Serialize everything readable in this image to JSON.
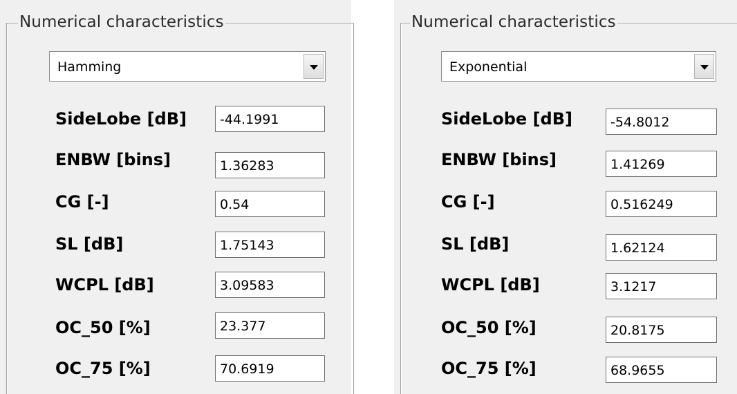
{
  "panels": [
    {
      "group_title": "Numerical characteristics",
      "window_type": "Hamming",
      "rows": [
        {
          "label": "SideLobe [dB]",
          "value": "-44.1991"
        },
        {
          "label": "ENBW [bins]",
          "value": "1.36283"
        },
        {
          "label": "CG [-]",
          "value": "0.54"
        },
        {
          "label": "SL [dB]",
          "value": "1.75143"
        },
        {
          "label": "WCPL [dB]",
          "value": "3.09583"
        },
        {
          "label": "OC_50 [%]",
          "value": "23.377"
        },
        {
          "label": "OC_75 [%]",
          "value": "70.6919"
        }
      ]
    },
    {
      "group_title": "Numerical characteristics",
      "window_type": "Exponential",
      "rows": [
        {
          "label": "SideLobe [dB]",
          "value": "-54.8012"
        },
        {
          "label": "ENBW [bins]",
          "value": "1.41269"
        },
        {
          "label": "CG [-]",
          "value": "0.516249"
        },
        {
          "label": "SL [dB]",
          "value": "1.62124"
        },
        {
          "label": "WCPL [dB]",
          "value": "3.1217"
        },
        {
          "label": "OC_50 [%]",
          "value": "20.8175"
        },
        {
          "label": "OC_75 [%]",
          "value": "68.9655"
        }
      ]
    }
  ],
  "icons": {
    "dropdown": "chevron-down-icon"
  }
}
